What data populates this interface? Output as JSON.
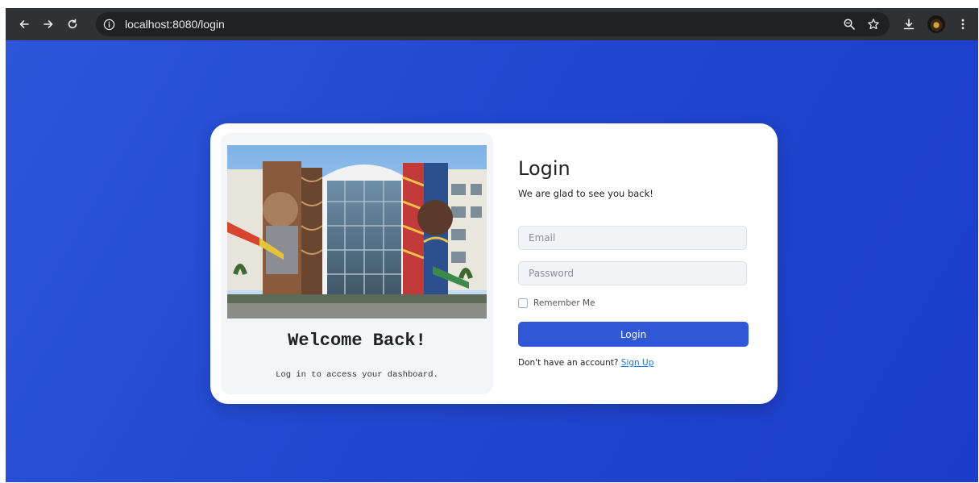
{
  "browser": {
    "url": "localhost:8080/login"
  },
  "left": {
    "title": "Welcome Back!",
    "subtitle": "Log in to access your dashboard."
  },
  "form": {
    "title": "Login",
    "subtitle": "We are glad to see you back!",
    "email_placeholder": "Email",
    "password_placeholder": "Password",
    "remember_label": "Remember Me",
    "remember_checked": false,
    "submit_label": "Login",
    "signup_prompt": "Don't have an account?",
    "signup_link": "Sign Up"
  },
  "colors": {
    "background": "#2247d0",
    "primary_button": "#2f57d6",
    "link": "#1a73e8"
  }
}
